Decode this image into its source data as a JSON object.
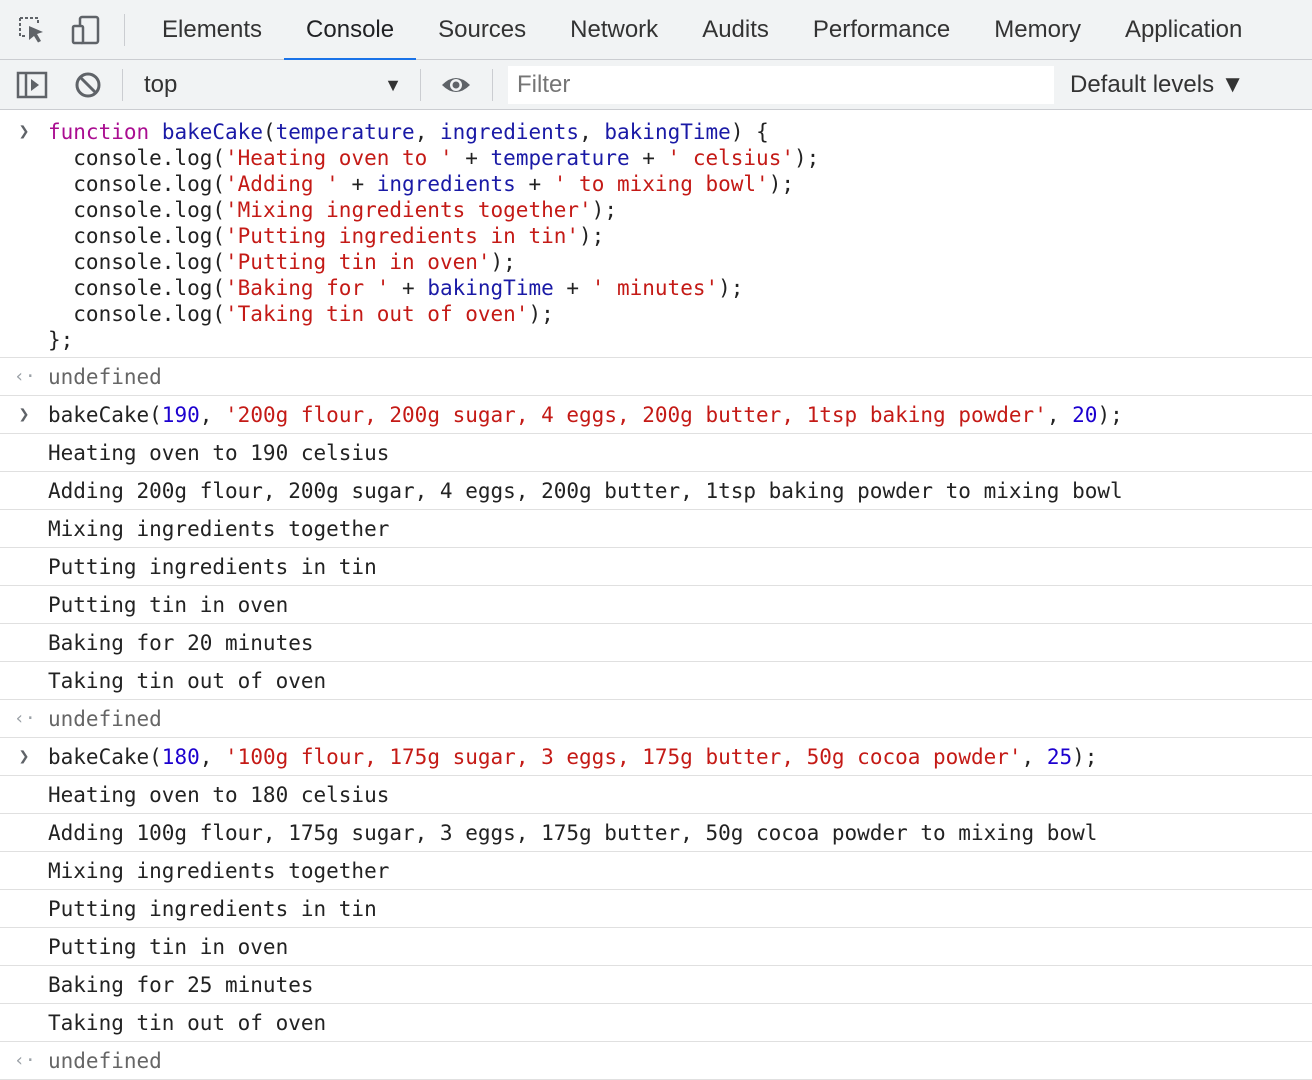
{
  "tabs": [
    "Elements",
    "Console",
    "Sources",
    "Network",
    "Audits",
    "Performance",
    "Memory",
    "Application"
  ],
  "active_tab": "Console",
  "toolbar": {
    "context": "top",
    "filter_placeholder": "Filter",
    "filter_value": "",
    "levels": "Default levels ▼"
  },
  "colors": {
    "keyword": "#aa0d91",
    "function": "#1a1aa6",
    "string": "#c41a16",
    "number": "#1c00cf",
    "accent": "#1a73e8"
  },
  "function_definition": [
    [
      [
        "kw",
        "function"
      ],
      [
        "pl",
        " "
      ],
      [
        "fn",
        "bakeCake"
      ],
      [
        "pl",
        "("
      ],
      [
        "var",
        "temperature"
      ],
      [
        "pl",
        ", "
      ],
      [
        "var",
        "ingredients"
      ],
      [
        "pl",
        ", "
      ],
      [
        "var",
        "bakingTime"
      ],
      [
        "pl",
        ") {"
      ]
    ],
    [
      [
        "pl",
        "  console.log("
      ],
      [
        "str",
        "'Heating oven to '"
      ],
      [
        "pl",
        " + "
      ],
      [
        "var",
        "temperature"
      ],
      [
        "pl",
        " + "
      ],
      [
        "str",
        "' celsius'"
      ],
      [
        "pl",
        ");"
      ]
    ],
    [
      [
        "pl",
        "  console.log("
      ],
      [
        "str",
        "'Adding '"
      ],
      [
        "pl",
        " + "
      ],
      [
        "var",
        "ingredients"
      ],
      [
        "pl",
        " + "
      ],
      [
        "str",
        "' to mixing bowl'"
      ],
      [
        "pl",
        ");"
      ]
    ],
    [
      [
        "pl",
        "  console.log("
      ],
      [
        "str",
        "'Mixing ingredients together'"
      ],
      [
        "pl",
        ");"
      ]
    ],
    [
      [
        "pl",
        "  console.log("
      ],
      [
        "str",
        "'Putting ingredients in tin'"
      ],
      [
        "pl",
        ");"
      ]
    ],
    [
      [
        "pl",
        "  console.log("
      ],
      [
        "str",
        "'Putting tin in oven'"
      ],
      [
        "pl",
        ");"
      ]
    ],
    [
      [
        "pl",
        "  console.log("
      ],
      [
        "str",
        "'Baking for '"
      ],
      [
        "pl",
        " + "
      ],
      [
        "var",
        "bakingTime"
      ],
      [
        "pl",
        " + "
      ],
      [
        "str",
        "' minutes'"
      ],
      [
        "pl",
        ");"
      ]
    ],
    [
      [
        "pl",
        "  console.log("
      ],
      [
        "str",
        "'Taking tin out of oven'"
      ],
      [
        "pl",
        ");"
      ]
    ],
    [
      [
        "pl",
        "};"
      ]
    ]
  ],
  "result_after_definition": "undefined",
  "calls": [
    {
      "input": [
        [
          "pl",
          "bakeCake("
        ],
        [
          "num",
          "190"
        ],
        [
          "pl",
          ", "
        ],
        [
          "str",
          "'200g flour, 200g sugar, 4 eggs, 200g butter, 1tsp baking powder'"
        ],
        [
          "pl",
          ", "
        ],
        [
          "num",
          "20"
        ],
        [
          "pl",
          ");"
        ]
      ],
      "logs": [
        "Heating oven to 190 celsius",
        "Adding 200g flour, 200g sugar, 4 eggs, 200g butter, 1tsp baking powder to mixing bowl",
        "Mixing ingredients together",
        "Putting ingredients in tin",
        "Putting tin in oven",
        "Baking for 20 minutes",
        "Taking tin out of oven"
      ],
      "result": "undefined"
    },
    {
      "input": [
        [
          "pl",
          "bakeCake("
        ],
        [
          "num",
          "180"
        ],
        [
          "pl",
          ", "
        ],
        [
          "str",
          "'100g flour, 175g sugar, 3 eggs, 175g butter, 50g cocoa powder'"
        ],
        [
          "pl",
          ", "
        ],
        [
          "num",
          "25"
        ],
        [
          "pl",
          ");"
        ]
      ],
      "logs": [
        "Heating oven to 180 celsius",
        "Adding 100g flour, 175g sugar, 3 eggs, 175g butter, 50g cocoa powder to mixing bowl",
        "Mixing ingredients together",
        "Putting ingredients in tin",
        "Putting tin in oven",
        "Baking for 25 minutes",
        "Taking tin out of oven"
      ],
      "result": "undefined"
    }
  ]
}
